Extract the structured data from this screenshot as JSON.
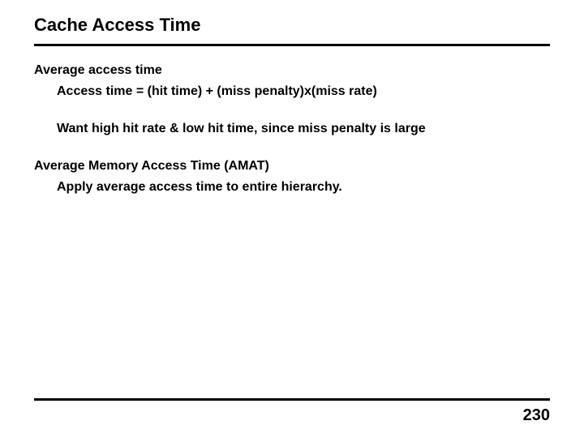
{
  "title": "Cache Access Time",
  "content": {
    "section1": {
      "heading": "Average access time",
      "line1": "Access time = (hit time) + (miss penalty)x(miss rate)",
      "line2": "Want high hit rate & low hit time, since miss penalty is large"
    },
    "section2": {
      "heading": "Average Memory Access Time (AMAT)",
      "line1": "Apply average access time to entire hierarchy."
    }
  },
  "page_number": "230"
}
